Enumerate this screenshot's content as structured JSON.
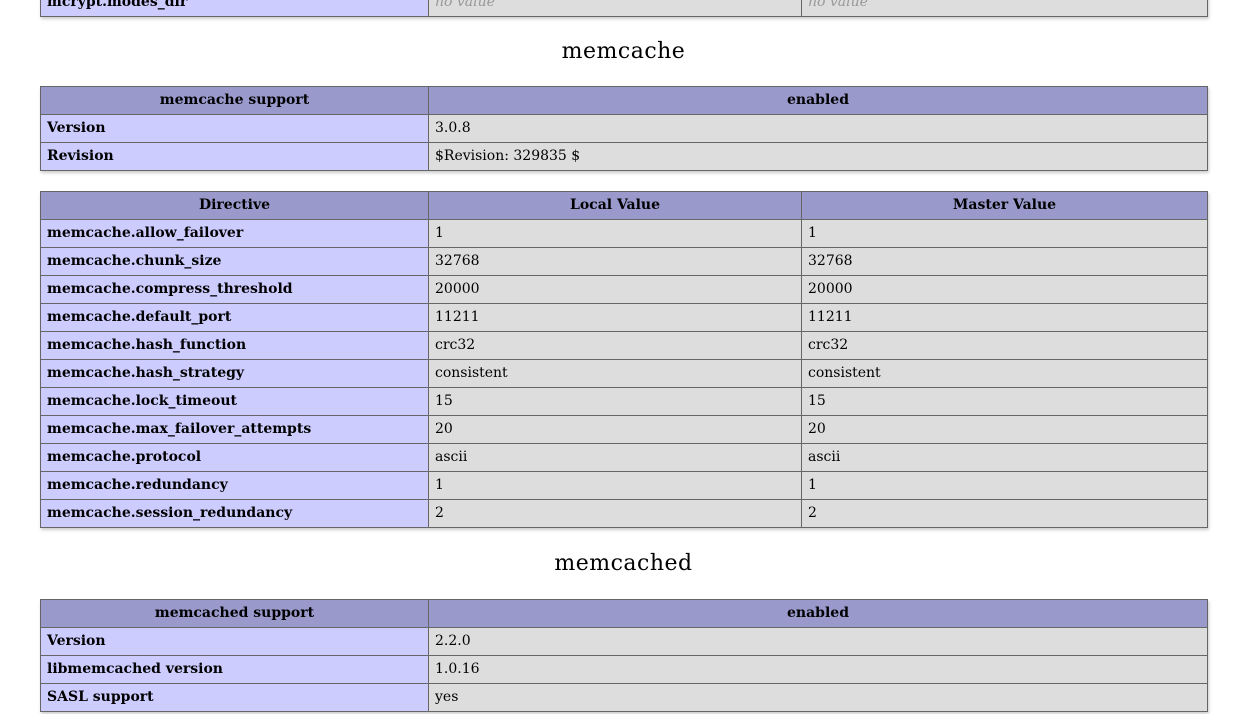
{
  "top_row": {
    "directive": "mcrypt.modes_dir",
    "local": "no value",
    "master": "no value"
  },
  "memcache": {
    "title": "memcache",
    "info": {
      "header": [
        "memcache support",
        "enabled"
      ],
      "rows": [
        [
          "Version",
          "3.0.8"
        ],
        [
          "Revision",
          "$Revision: 329835 $"
        ]
      ]
    },
    "directives": {
      "header": [
        "Directive",
        "Local Value",
        "Master Value"
      ],
      "rows": [
        [
          "memcache.allow_failover",
          "1",
          "1"
        ],
        [
          "memcache.chunk_size",
          "32768",
          "32768"
        ],
        [
          "memcache.compress_threshold",
          "20000",
          "20000"
        ],
        [
          "memcache.default_port",
          "11211",
          "11211"
        ],
        [
          "memcache.hash_function",
          "crc32",
          "crc32"
        ],
        [
          "memcache.hash_strategy",
          "consistent",
          "consistent"
        ],
        [
          "memcache.lock_timeout",
          "15",
          "15"
        ],
        [
          "memcache.max_failover_attempts",
          "20",
          "20"
        ],
        [
          "memcache.protocol",
          "ascii",
          "ascii"
        ],
        [
          "memcache.redundancy",
          "1",
          "1"
        ],
        [
          "memcache.session_redundancy",
          "2",
          "2"
        ]
      ]
    }
  },
  "memcached": {
    "title": "memcached",
    "info": {
      "header": [
        "memcached support",
        "enabled"
      ],
      "rows": [
        [
          "Version",
          "2.2.0"
        ],
        [
          "libmemcached version",
          "1.0.16"
        ],
        [
          "SASL support",
          "yes"
        ]
      ]
    }
  }
}
